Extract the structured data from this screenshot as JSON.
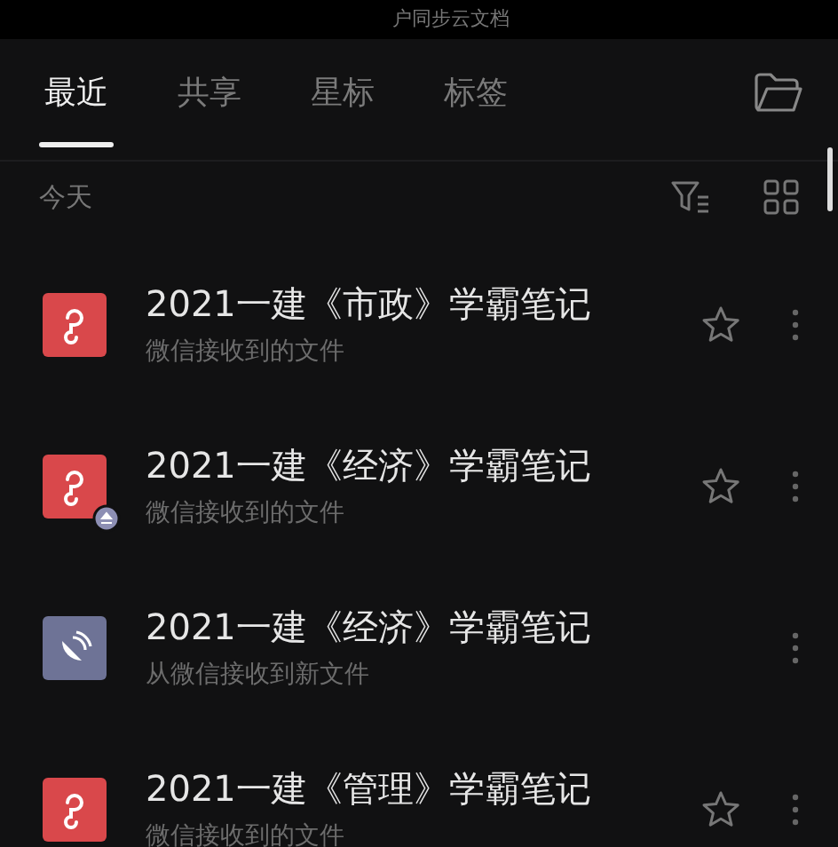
{
  "banner": {
    "text": "户同步云文档"
  },
  "tabs": [
    {
      "label": "最近",
      "selected": true
    },
    {
      "label": "共享",
      "selected": false
    },
    {
      "label": "星标",
      "selected": false
    },
    {
      "label": "标签",
      "selected": false
    }
  ],
  "section": {
    "label": "今天"
  },
  "files": [
    {
      "title": "2021一建《市政》学霸笔记",
      "subtitle": "微信接收到的文件",
      "kind": "pdf",
      "upload_badge": false,
      "star_button": true
    },
    {
      "title": "2021一建《经济》学霸笔记",
      "subtitle": "微信接收到的文件",
      "kind": "pdf",
      "upload_badge": true,
      "star_button": true
    },
    {
      "title": "2021一建《经济》学霸笔记",
      "subtitle": "从微信接收到新文件",
      "kind": "link",
      "upload_badge": false,
      "star_button": false
    },
    {
      "title": "2021一建《管理》学霸笔记",
      "subtitle": "微信接收到的文件",
      "kind": "pdf",
      "upload_badge": false,
      "star_button": true
    }
  ]
}
